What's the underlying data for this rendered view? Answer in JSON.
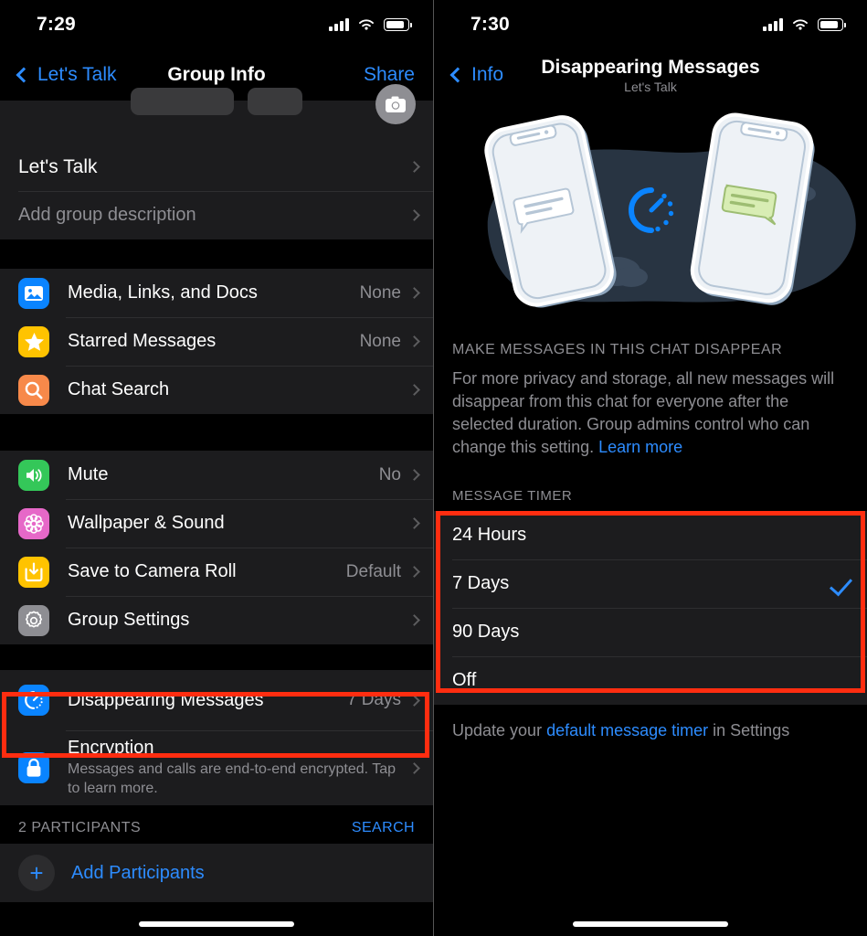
{
  "left": {
    "status": {
      "time": "7:29"
    },
    "nav": {
      "back_label": "Let's Talk",
      "title": "Group Info",
      "action_label": "Share"
    },
    "group": {
      "name": "Let's Talk",
      "description_placeholder": "Add group description"
    },
    "section_media": [
      {
        "label": "Media, Links, and Docs",
        "value": "None",
        "icon": "photo-icon",
        "color": "#0a84ff"
      },
      {
        "label": "Starred Messages",
        "value": "None",
        "icon": "star-icon",
        "color": "#ffc300"
      },
      {
        "label": "Chat Search",
        "value": "",
        "icon": "search-icon",
        "color": "#f7894a"
      }
    ],
    "section_settings": [
      {
        "label": "Mute",
        "value": "No",
        "icon": "speaker-icon",
        "color": "#34c759"
      },
      {
        "label": "Wallpaper & Sound",
        "value": "",
        "icon": "flower-icon",
        "color": "#e668c8"
      },
      {
        "label": "Save to Camera Roll",
        "value": "Default",
        "icon": "download-icon",
        "color": "#ffc300"
      },
      {
        "label": "Group Settings",
        "value": "",
        "icon": "gear-icon",
        "color": "#8e8e93"
      }
    ],
    "section_privacy": {
      "disappearing": {
        "label": "Disappearing Messages",
        "value": "7 Days",
        "icon": "timer-icon",
        "color": "#0a84ff"
      },
      "encryption": {
        "label": "Encryption",
        "subtext": "Messages and calls are end-to-end encrypted. Tap to learn more.",
        "icon": "lock-icon",
        "color": "#0a84ff"
      }
    },
    "participants": {
      "header": "2 PARTICIPANTS",
      "search_label": "SEARCH",
      "add_label": "Add Participants"
    }
  },
  "right": {
    "status": {
      "time": "7:30"
    },
    "nav": {
      "back_label": "Info",
      "title": "Disappearing Messages",
      "subtitle": "Let's Talk"
    },
    "caption": "MAKE MESSAGES IN THIS CHAT DISAPPEAR",
    "body_text": "For more privacy and storage, all new messages will disappear from this chat for everyone after the selected duration. Group admins control who can change this setting. ",
    "body_link": "Learn more",
    "timer_header": "MESSAGE TIMER",
    "timer_options": [
      {
        "label": "24 Hours",
        "selected": false
      },
      {
        "label": "7 Days",
        "selected": true
      },
      {
        "label": "90 Days",
        "selected": false
      },
      {
        "label": "Off",
        "selected": false
      }
    ],
    "footer_prefix": "Update your ",
    "footer_link": "default message timer",
    "footer_suffix": " in Settings"
  },
  "highlight_color": "#ff2d10"
}
